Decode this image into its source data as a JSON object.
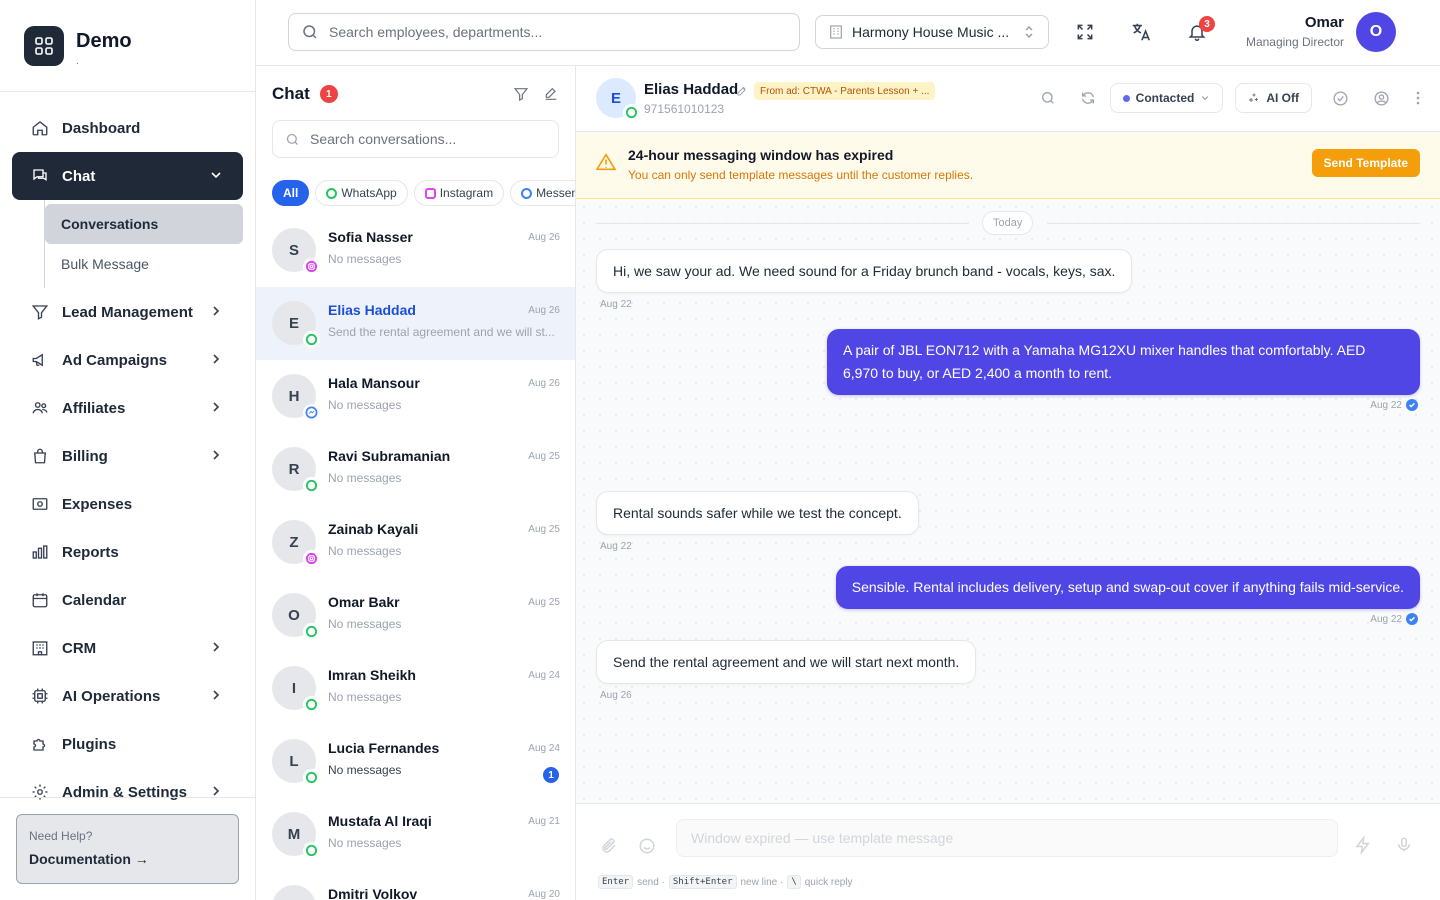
{
  "brand": {
    "name": "Demo",
    "sub": "."
  },
  "nav": {
    "dashboard": "Dashboard",
    "chat": "Chat",
    "conversations": "Conversations",
    "bulk": "Bulk Message",
    "lead": "Lead Management",
    "ads": "Ad Campaigns",
    "affiliates": "Affiliates",
    "billing": "Billing",
    "expenses": "Expenses",
    "reports": "Reports",
    "calendar": "Calendar",
    "crm": "CRM",
    "ai_ops": "AI Operations",
    "plugins": "Plugins",
    "admin": "Admin & Settings"
  },
  "help": {
    "title": "Need Help?",
    "link": "Documentation →"
  },
  "topbar": {
    "search_placeholder": "Search employees, departments...",
    "company": "Harmony House Music ...",
    "notif_count": "3",
    "user_name": "Omar",
    "user_role": "Managing Director",
    "user_initial": "O"
  },
  "chatlist": {
    "title": "Chat",
    "badge": "1",
    "search_placeholder": "Search conversations...",
    "filters": [
      "All",
      "WhatsApp",
      "Instagram",
      "Messen"
    ],
    "conversations": [
      {
        "initial": "S",
        "name": "Sofia Nasser",
        "preview": "No messages",
        "date": "Aug 26",
        "channel": "instagram"
      },
      {
        "initial": "E",
        "name": "Elias Haddad",
        "preview": "Send the rental agreement and we will st...",
        "date": "Aug 26",
        "channel": "whatsapp"
      },
      {
        "initial": "H",
        "name": "Hala Mansour",
        "preview": "No messages",
        "date": "Aug 26",
        "channel": "messenger"
      },
      {
        "initial": "R",
        "name": "Ravi Subramanian",
        "preview": "No messages",
        "date": "Aug 25",
        "channel": "whatsapp"
      },
      {
        "initial": "Z",
        "name": "Zainab Kayali",
        "preview": "No messages",
        "date": "Aug 25",
        "channel": "instagram"
      },
      {
        "initial": "O",
        "name": "Omar Bakr",
        "preview": "No messages",
        "date": "Aug 25",
        "channel": "whatsapp"
      },
      {
        "initial": "I",
        "name": "Imran Sheikh",
        "preview": "No messages",
        "date": "Aug 24",
        "channel": "whatsapp"
      },
      {
        "initial": "L",
        "name": "Lucia Fernandes",
        "preview": "No messages",
        "date": "Aug 24",
        "channel": "whatsapp",
        "unread": "1"
      },
      {
        "initial": "M",
        "name": "Mustafa Al Iraqi",
        "preview": "No messages",
        "date": "Aug 21",
        "channel": "whatsapp"
      },
      {
        "initial": "D",
        "name": "Dmitri Volkov",
        "preview": "",
        "date": "Aug 20",
        "channel": "whatsapp"
      }
    ]
  },
  "chat": {
    "contact_initial": "E",
    "contact_name": "Elias Haddad",
    "contact_phone": "971561010123",
    "source": "From ad: CTWA - Parents Lesson + ...",
    "status": "Contacted",
    "ai": "AI Off",
    "warning_title": "24-hour messaging window has expired",
    "warning_sub": "You can only send template messages until the customer replies.",
    "send_template": "Send Template",
    "today": "Today",
    "messages": [
      {
        "dir": "in",
        "text": "Hi, we saw your ad. We need sound for a Friday brunch band - vocals, keys, sax.",
        "time": "Aug 22"
      },
      {
        "dir": "out",
        "text": "A pair of JBL EON712 with a Yamaha MG12XU mixer handles that comfortably. AED 6,970 to buy, or AED 2,400 a month to rent.",
        "time": "Aug 22"
      },
      {
        "dir": "in",
        "text": "Rental sounds safer while we test the concept.",
        "time": "Aug 22"
      },
      {
        "dir": "out",
        "text": "Sensible. Rental includes delivery, setup and swap-out cover if anything fails mid-service.",
        "time": "Aug 22"
      },
      {
        "dir": "in",
        "text": "Send the rental agreement and we will start next month.",
        "time": "Aug 26"
      }
    ],
    "composer_placeholder": "Window expired — use template message",
    "hint_enter": "Enter",
    "hint_send": "send ·",
    "hint_shift": "Shift+Enter",
    "hint_newline": "new line ·",
    "hint_slash": "\\",
    "hint_quick": "quick reply"
  },
  "colors": {
    "accent": "#4f46e5",
    "dark": "#1f2937",
    "warning": "#f59e0b",
    "whatsapp": "#22c55e",
    "instagram": "#d946ef",
    "messenger": "#3b82f6"
  }
}
